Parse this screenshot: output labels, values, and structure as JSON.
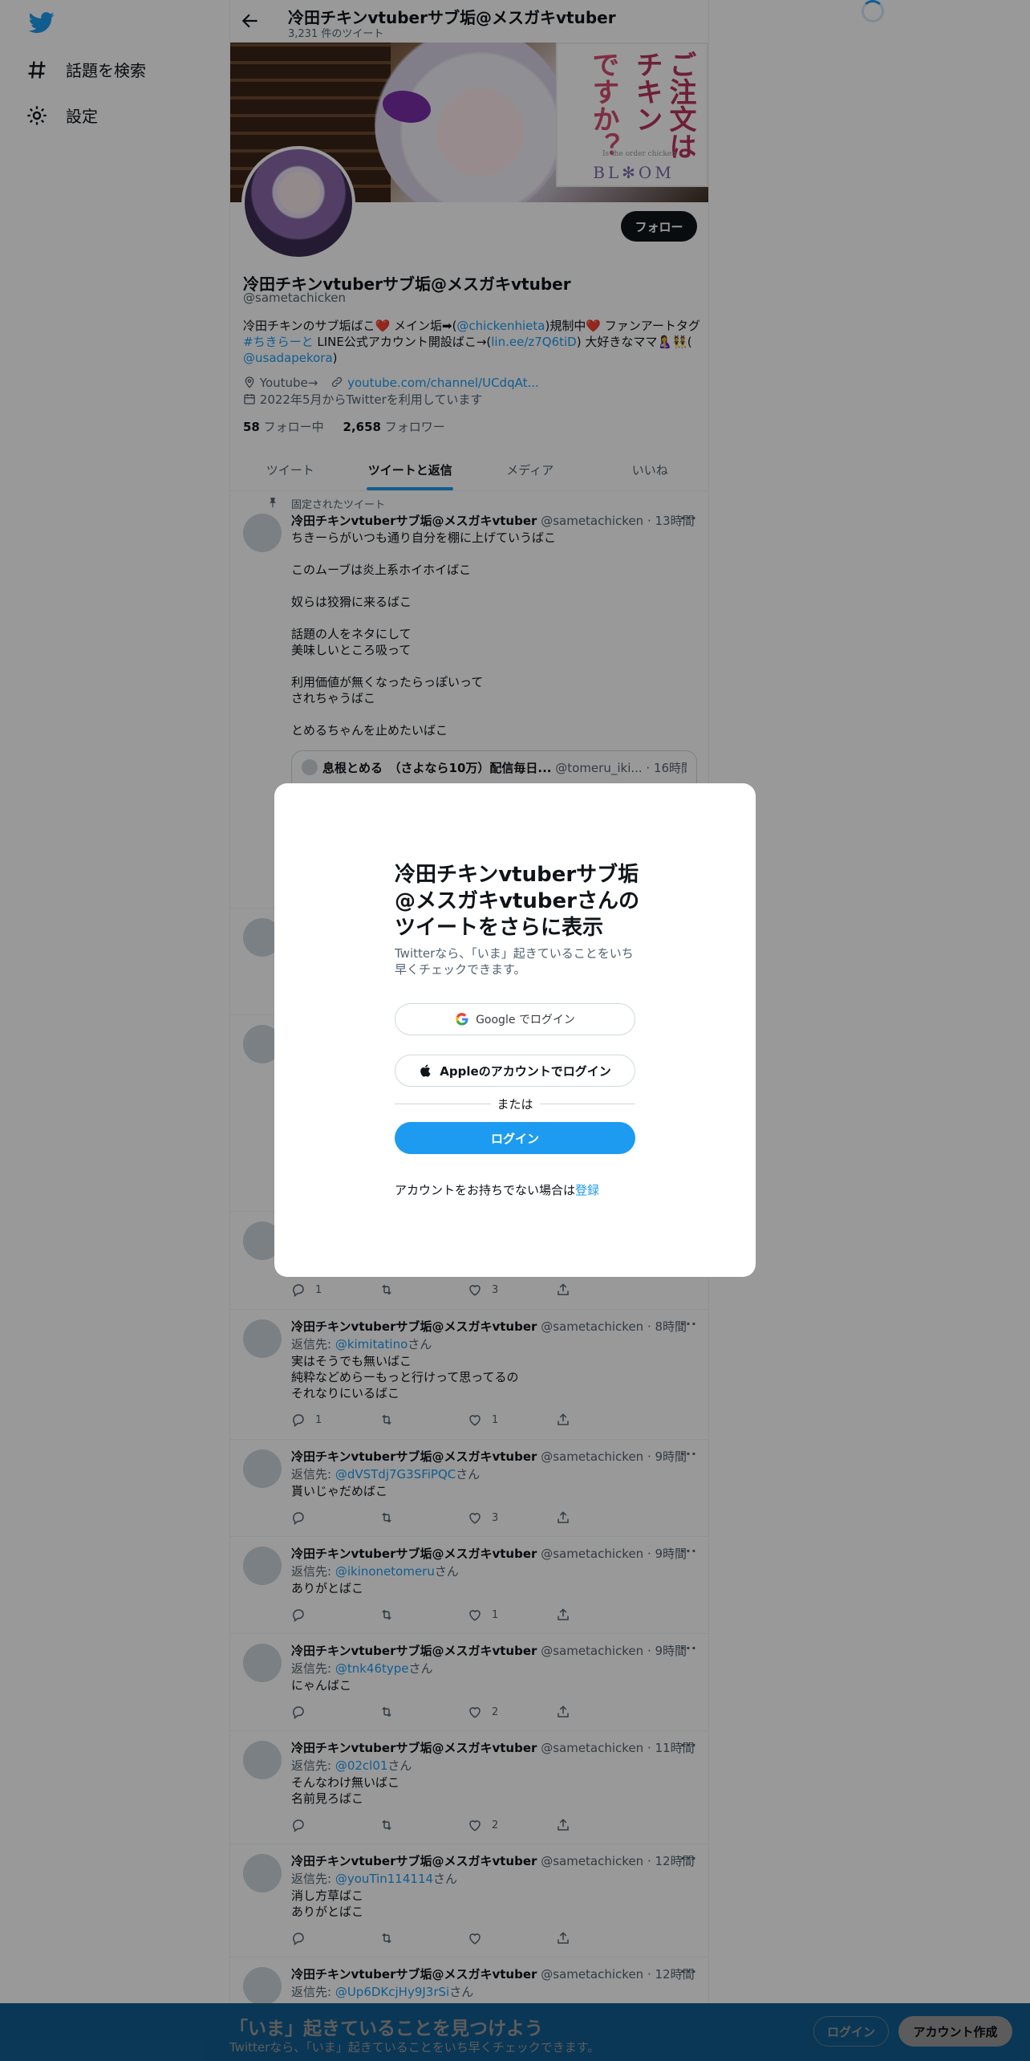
{
  "nav": {
    "explore_label": "話題を検索",
    "settings_label": "設定"
  },
  "header": {
    "title": "冷田チキンvtuberサブ垢@メスガキvtuber",
    "tweet_count": "3,231 件のツイート"
  },
  "banner": {
    "book_title_col1": "ご注文は",
    "book_title_col2": "チキン",
    "book_title_col3": "ですか？",
    "book_subtitle": "Is the order chicken",
    "book_bloom": "BL✻OM"
  },
  "profile": {
    "follow_label": "フォロー",
    "name": "冷田チキンvtuberサブ垢@メスガキvtuber",
    "handle": "@sametachicken",
    "bio_part1": "冷田チキンのサブ垢ばこ❤️ メイン垢➡(",
    "bio_link1": "@chickenhieta",
    "bio_part2": ")規制中❤️ ファンアートタグ",
    "bio_link2": "#ちきらーと",
    "bio_part3": " LINE公式アカウント開設ばこ→(",
    "bio_link3": "lin.ee/z7Q6tiD",
    "bio_part4": ") 大好きなママ🤱👯(",
    "bio_link4": "@usadapekora",
    "bio_part5": ")",
    "location": "Youtube→",
    "url": "youtube.com/channel/UCdqAt...",
    "joined": "2022年5月からTwitterを利用しています",
    "following_count": "58",
    "following_label": "フォロー中",
    "followers_count": "2,658",
    "followers_label": "フォロワー"
  },
  "tabs": [
    "ツイート",
    "ツイートと返信",
    "メディア",
    "いいね"
  ],
  "pinned": {
    "label": "固定されたツイート",
    "name": "冷田チキンvtuberサブ垢@メスガキvtuber",
    "meta": "@sametachicken · 13時間",
    "text": "ちきーらがいつも通り自分を棚に上げていうばこ\n\nこのムーブは炎上系ホイホイばこ\n\n奴らは狡猾に来るばこ\n\n話題の人をネタにして\n美味しいところ吸って\n\n利用価値が無くなったらっぽいって\nされちゃうばこ\n\nとめるちゃんを止めたいばこ",
    "quote_name": "息根とめる　（さよなら10万）配信毎日...",
    "quote_meta": "@tomeru_iki... · 16時間"
  },
  "reply_prefix": "返信先: ",
  "reply_suffix": "さん",
  "tweets": [
    {
      "actions": {
        "reply": "1",
        "retweet": "",
        "like": "3"
      }
    },
    {
      "name": "冷田チキンvtuberサブ垢@メスガキvtuber",
      "meta": "@sametachicken · 8時間",
      "reply_to": "@kimitatino",
      "text": "実はそうでも無いばこ\n純粋などめらーもっと行けって思ってるの\nそれなりにいるばこ",
      "actions": {
        "reply": "1",
        "retweet": "",
        "like": "1"
      }
    },
    {
      "name": "冷田チキンvtuberサブ垢@メスガキvtuber",
      "meta": "@sametachicken · 9時間",
      "reply_to": "@dVSTdj7G3SFiPQC",
      "text": "貰いじゃだめばこ",
      "actions": {
        "reply": "",
        "retweet": "",
        "like": "3"
      }
    },
    {
      "name": "冷田チキンvtuberサブ垢@メスガキvtuber",
      "meta": "@sametachicken · 9時間",
      "reply_to": "@ikinonetomeru",
      "text": "ありがとばこ",
      "actions": {
        "reply": "",
        "retweet": "",
        "like": "1"
      }
    },
    {
      "name": "冷田チキンvtuberサブ垢@メスガキvtuber",
      "meta": "@sametachicken · 9時間",
      "reply_to": "@tnk46type",
      "text": "にゃんばこ",
      "actions": {
        "reply": "",
        "retweet": "",
        "like": "2"
      }
    },
    {
      "name": "冷田チキンvtuberサブ垢@メスガキvtuber",
      "meta": "@sametachicken · 11時間",
      "reply_to": "@02cl01",
      "text": "そんなわけ無いばこ\n名前見ろばこ",
      "actions": {
        "reply": "",
        "retweet": "",
        "like": "2"
      }
    },
    {
      "name": "冷田チキンvtuberサブ垢@メスガキvtuber",
      "meta": "@sametachicken · 12時間",
      "reply_to": "@youTin114114",
      "text": "消し方草ばこ\nありがとばこ",
      "actions": {
        "reply": "",
        "retweet": "",
        "like": ""
      }
    },
    {
      "name": "冷田チキンvtuberサブ垢@メスガキvtuber",
      "meta": "@sametachicken · 12時間",
      "reply_to": "@Up6DKcjHy9J3rSi"
    }
  ],
  "modal": {
    "title": "冷田チキンvtuberサブ垢@メスガキvtuberさんのツイートをさらに表示",
    "subtitle": "Twitterなら、「いま」起きていることをいち早くチェックできます。",
    "google_label": "Google でログイン",
    "apple_label": "Appleのアカウントでログイン",
    "or_label": "または",
    "login_label": "ログイン",
    "signup_prefix": "アカウントをお持ちでない場合は",
    "signup_link": "登録"
  },
  "bottom_bar": {
    "title": "「いま」起きていることを見つけよう",
    "subtitle": "Twitterなら、「いま」起きていることをいち早くチェックできます。",
    "login_label": "ログイン",
    "signup_label": "アカウント作成"
  },
  "colors": {
    "accent": "#1d9bf0",
    "text": "#0f1419",
    "muted": "#536471"
  }
}
